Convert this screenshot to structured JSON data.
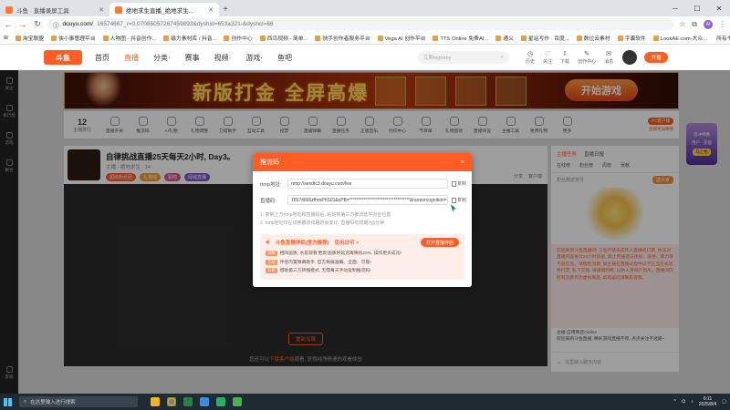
{
  "browser": {
    "tabs": [
      {
        "label": "斗鱼 · 直播录屏工具",
        "active": false
      },
      {
        "label": "绝地求生直播_绝地求生...",
        "active": true
      }
    ],
    "url_host": "douyu.com/",
    "url_path": "16574667_r=0.07085057267459893&dyshid=653a321-&dyshcl=66",
    "bookmarks": [
      "淘宝联盟",
      "侠小事管理平台",
      "人物图 - 抖音创作...",
      "磁力素材库 / 抖音...",
      "创作中心",
      "西瓜视频 - 简单...",
      "快手创作者服务平台",
      "Vega AI 创作平台",
      "TTS Online 免费AI...",
      "通义",
      "星站写作 · 百度...",
      "数位云素材",
      "字囊软件",
      "LookAE.com-大众..."
    ],
    "bookmarks_right": "所有书签",
    "profile": "AI"
  },
  "site": {
    "logo": "斗鱼",
    "nav": [
      "首页",
      "直播",
      "分类·",
      "赛事",
      "视频·",
      "游戏·",
      "鱼吧"
    ],
    "nav_active": 1,
    "search_placeholder": "艾斯bigbaby",
    "header_icons": [
      "历史",
      "关注",
      "下载",
      "创作中心",
      "消息"
    ],
    "open_button": "开播"
  },
  "sidebar": [
    "关注",
    "排行榜",
    "游戏",
    "聚合"
  ],
  "sidebar_bottom": "客服",
  "banner": {
    "title": "新版打金 全屏高爆",
    "cta": "开始游戏"
  },
  "giftbar": {
    "rank_number": "12",
    "rank_label": "主播排行",
    "tools": [
      "直播开关",
      "推流码",
      "AI礼物",
      "礼物调整",
      "刀塔助手",
      "互动工具",
      "投票",
      "直播弹幕",
      "直播任务",
      "正版音乐",
      "创作中心",
      "节目单",
      "礼物音效",
      "直播间设",
      "主播工具",
      "免费礼物",
      "更多"
    ],
    "pc_badge": "PC客户端",
    "pc_sub": "直播更加便捷"
  },
  "stream": {
    "title": "自律挑战直播25天每天2小时, Day3。",
    "meta": "主播 · 绝地求生 · 14",
    "tags": [
      "超级粉丝团",
      "礼物墙",
      "贴吧",
      "绿城直播"
    ],
    "right_items": [
      "分享",
      "客户端"
    ]
  },
  "player": {
    "button": "重新加载",
    "below_text": "您还可以",
    "below_link": "下载客户端",
    "below_tail": "观看, 获得纯净极速的观看体验"
  },
  "right_panel": {
    "head_items": [
      "主播任务",
      "直播日报"
    ],
    "tabs": [
      "在线榜",
      "粉丝榜",
      "周榜",
      "贡献"
    ],
    "gift_label": "粉丝赠送奖号",
    "gift_button": "送大家",
    "chat_text": "欢迎来到斗鱼直播间! 斗鱼严禁未成年人直播或打赏, 依法对直播内容进行24小时巡查, 禁止传播违法违规、低俗、暴力等不良信息。请理性消费, 如主播在直播过程中以不正当方式诱导打赏, 私下交易, 请谨慎判断, 以防人身财产损失。直播间内所有消费均为虚拟商品, 如有疑问请联系客服。",
    "sys_user": "主播",
    "sys_badge": "应用商店Online",
    "sys_text": "欢迎来到斗鱼直播, 精彩游戏直播不停, 点点关注不迷路~",
    "input_placeholder": "这里输入聊天内容"
  },
  "far_right_ad": {
    "line1": "首冲特惠",
    "line2": "用户 · 充值",
    "cta": "马上抢"
  },
  "modal": {
    "title": "推流码",
    "close": "×",
    "rtmp_label": "rtmp地址:",
    "rtmp_value": "rtmp://sendtc3.douyu.com/live",
    "code_label": "直播码:",
    "code_value": "16574666zfhrnPhS01&cPB=**********************************&noreorcognition=",
    "copy_label": "复制",
    "tip1": "1. 复制上方rtmp地址和直播码后, 粘贴到第三方推流软件对应位置",
    "tip2": "2. rtmp地址仅在切换推流线路时会变化, 直播码有效期为5分钟",
    "promo_title": "斗鱼直播伴侣(官方推荐)",
    "promo_more": "使用说明 >",
    "promo_open": "打开直播伴侣",
    "promo_lines": [
      {
        "k": "流畅",
        "t": "相同画质, 水友观看'更高'画质时延迟再降低20%, 操作更多成功!"
      },
      {
        "k": "互动",
        "t": "伴侣内置弹幕助手, 官方数据准确、全面、可靠!"
      },
      {
        "k": "方便",
        "t": "借助第三方转播模式, 无需每天手动复制推流码!"
      }
    ]
  },
  "taskbar": {
    "search": "在这里输入进行搜索",
    "time": "6:11",
    "date": "2025/8/4"
  },
  "colors": {
    "accent": "#ff5d23",
    "chrome_bg": "#dfe3e8",
    "taskbar": "#1f2a33"
  }
}
